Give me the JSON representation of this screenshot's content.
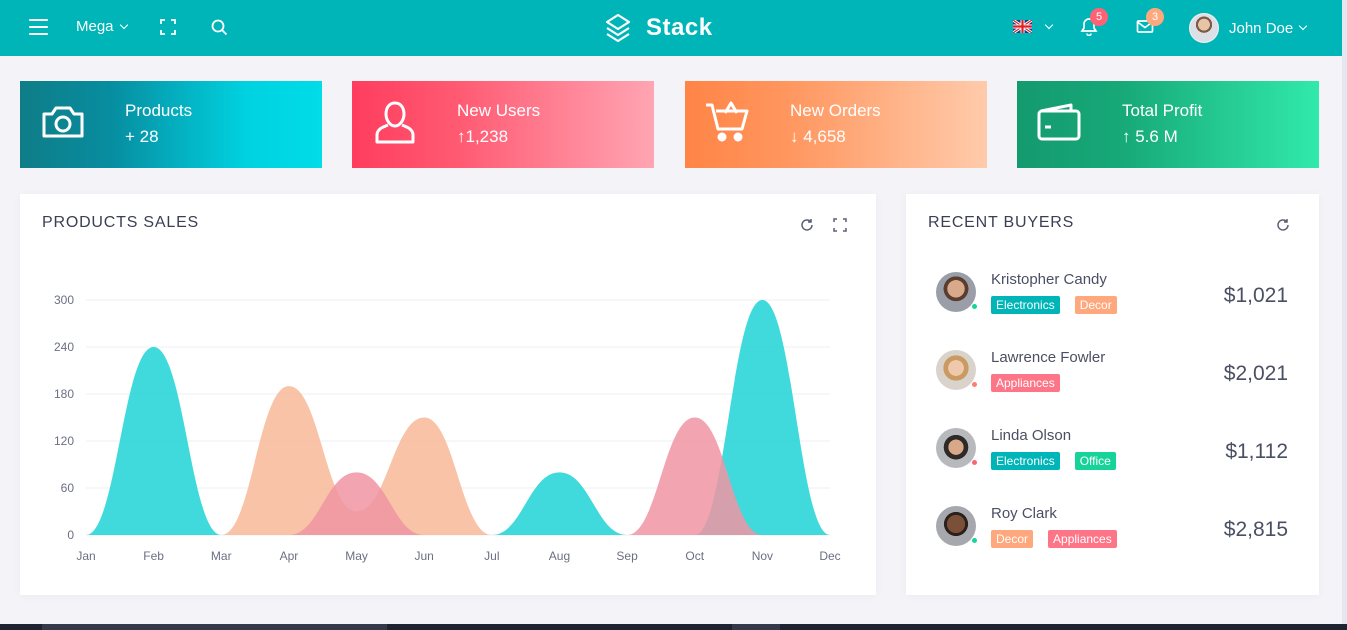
{
  "navbar": {
    "mega_label": "Mega",
    "brand": "Stack",
    "notifications_count": "5",
    "messages_count": "3",
    "user_name": "John Doe",
    "language": "en-GB flag"
  },
  "stats": [
    {
      "label": "Products",
      "value": "+ 28",
      "icon": "camera-icon"
    },
    {
      "label": "New Users",
      "value": "↑1,238",
      "icon": "user-icon"
    },
    {
      "label": "New Orders",
      "value": "↓ 4,658",
      "icon": "cart-icon"
    },
    {
      "label": "Total Profit",
      "value": "↑ 5.6 M",
      "icon": "wallet-icon"
    }
  ],
  "sales_panel": {
    "title": "PRODUCTS SALES"
  },
  "buyers_panel": {
    "title": "RECENT BUYERS",
    "buyers": [
      {
        "name": "Kristopher Candy",
        "amount": "$1,021",
        "status": "#16d39a",
        "tags": [
          {
            "text": "Electronics",
            "color": "#00b5b8"
          },
          {
            "text": "Decor",
            "color": "#ffa87d"
          }
        ]
      },
      {
        "name": "Lawrence Fowler",
        "amount": "$2,021",
        "status": "#ff7d6e",
        "tags": [
          {
            "text": "Appliances",
            "color": "#ff7588"
          }
        ]
      },
      {
        "name": "Linda Olson",
        "amount": "$1,112",
        "status": "#ff6275",
        "tags": [
          {
            "text": "Electronics",
            "color": "#00b5b8"
          },
          {
            "text": "Office",
            "color": "#16d39a"
          }
        ]
      },
      {
        "name": "Roy Clark",
        "amount": "$2,815",
        "status": "#16d39a",
        "tags": [
          {
            "text": "Decor",
            "color": "#ffa87d"
          },
          {
            "text": "Appliances",
            "color": "#ff7588"
          }
        ]
      }
    ]
  },
  "chart_data": {
    "type": "area",
    "title": "PRODUCTS SALES",
    "categories": [
      "Jan",
      "Feb",
      "Mar",
      "Apr",
      "May",
      "Jun",
      "Jul",
      "Aug",
      "Sep",
      "Oct",
      "Nov",
      "Dec"
    ],
    "yticks": [
      0,
      60,
      120,
      180,
      240,
      300
    ],
    "ylim": [
      0,
      300
    ],
    "grid": true,
    "legend": "none",
    "series": [
      {
        "color": "#f7b896",
        "values": [
          0,
          0,
          0,
          190,
          30,
          150,
          0,
          0,
          0,
          0,
          0,
          0
        ]
      },
      {
        "color": "#1fd3d6",
        "values": [
          0,
          240,
          0,
          0,
          0,
          0,
          0,
          80,
          0,
          0,
          300,
          0
        ]
      },
      {
        "color": "#f094a2",
        "values": [
          0,
          0,
          0,
          0,
          80,
          0,
          0,
          0,
          0,
          150,
          0,
          0
        ]
      }
    ]
  }
}
